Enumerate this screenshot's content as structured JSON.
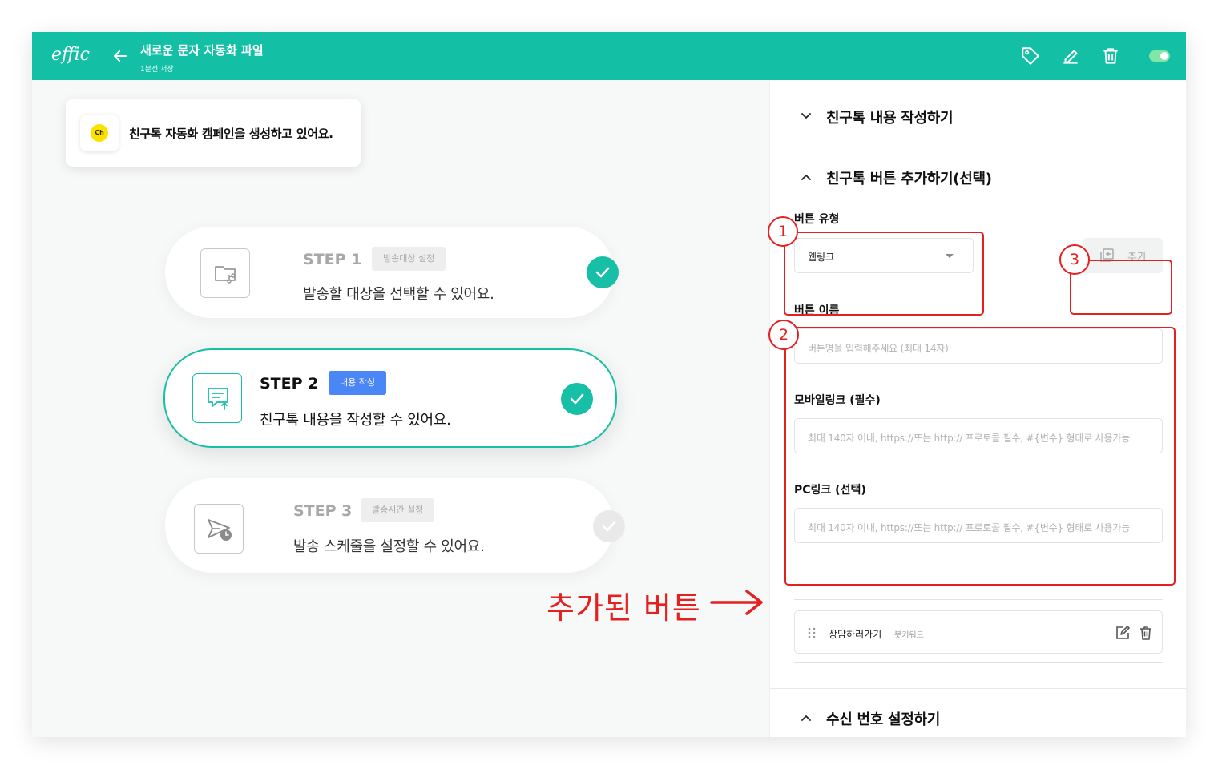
{
  "header": {
    "logo": "effic",
    "title": "새로운 문자 자동화 파일",
    "subtitle": "1분전 저장",
    "icons": [
      "tag-icon",
      "pencil-icon",
      "trash-icon"
    ],
    "toggle_on": true,
    "color": "#13c0a5"
  },
  "banner": {
    "icon_label": "Ch",
    "text": "친구톡 자동화 캠페인을 생성하고 있어요."
  },
  "steps": [
    {
      "name": "STEP 1",
      "badge": "발송대상 설정",
      "desc": "발송할 대상을 선택할 수 있어요.",
      "icon": "folder-branch-icon",
      "status": "done"
    },
    {
      "name": "STEP 2",
      "badge": "내용 작성",
      "desc": "친구톡 내용을 작성할 수 있어요.",
      "icon": "message-upload-icon",
      "status": "active"
    },
    {
      "name": "STEP 3",
      "badge": "발송시간 설정",
      "desc": "발송 스케줄을 설정할 수 있어요.",
      "icon": "send-clock-icon",
      "status": "pending"
    }
  ],
  "panel": {
    "sections": [
      {
        "title": "친구톡 내용 작성하기",
        "expanded": false
      },
      {
        "title": "친구톡 버튼 추가하기(선택)",
        "expanded": true
      },
      {
        "title": "수신 번호 설정하기",
        "expanded": true
      }
    ],
    "button_type": {
      "label": "버튼 유형",
      "value": "웹링크"
    },
    "add_button": {
      "label": "추가"
    },
    "button_name": {
      "label": "버튼 이름",
      "placeholder": "버튼명을 입력해주세요 (최대 14자)"
    },
    "mobile_link": {
      "label": "모바일링크 (필수)",
      "placeholder": "최대 140자 이내, https://또는 http:// 프로토콜 필수, #{변수} 형태로 사용가능"
    },
    "pc_link": {
      "label": "PC링크 (선택)",
      "placeholder": "최대 140자 이내, https://또는 http:// 프로토콜 필수, #{변수} 형태로 사용가능"
    },
    "added_button": {
      "name": "상담하러가기",
      "type": "봇키워드"
    }
  },
  "annotations": {
    "markers": [
      "1",
      "2",
      "3"
    ],
    "added_label": "추가된 버튼",
    "color": "#e42021"
  }
}
